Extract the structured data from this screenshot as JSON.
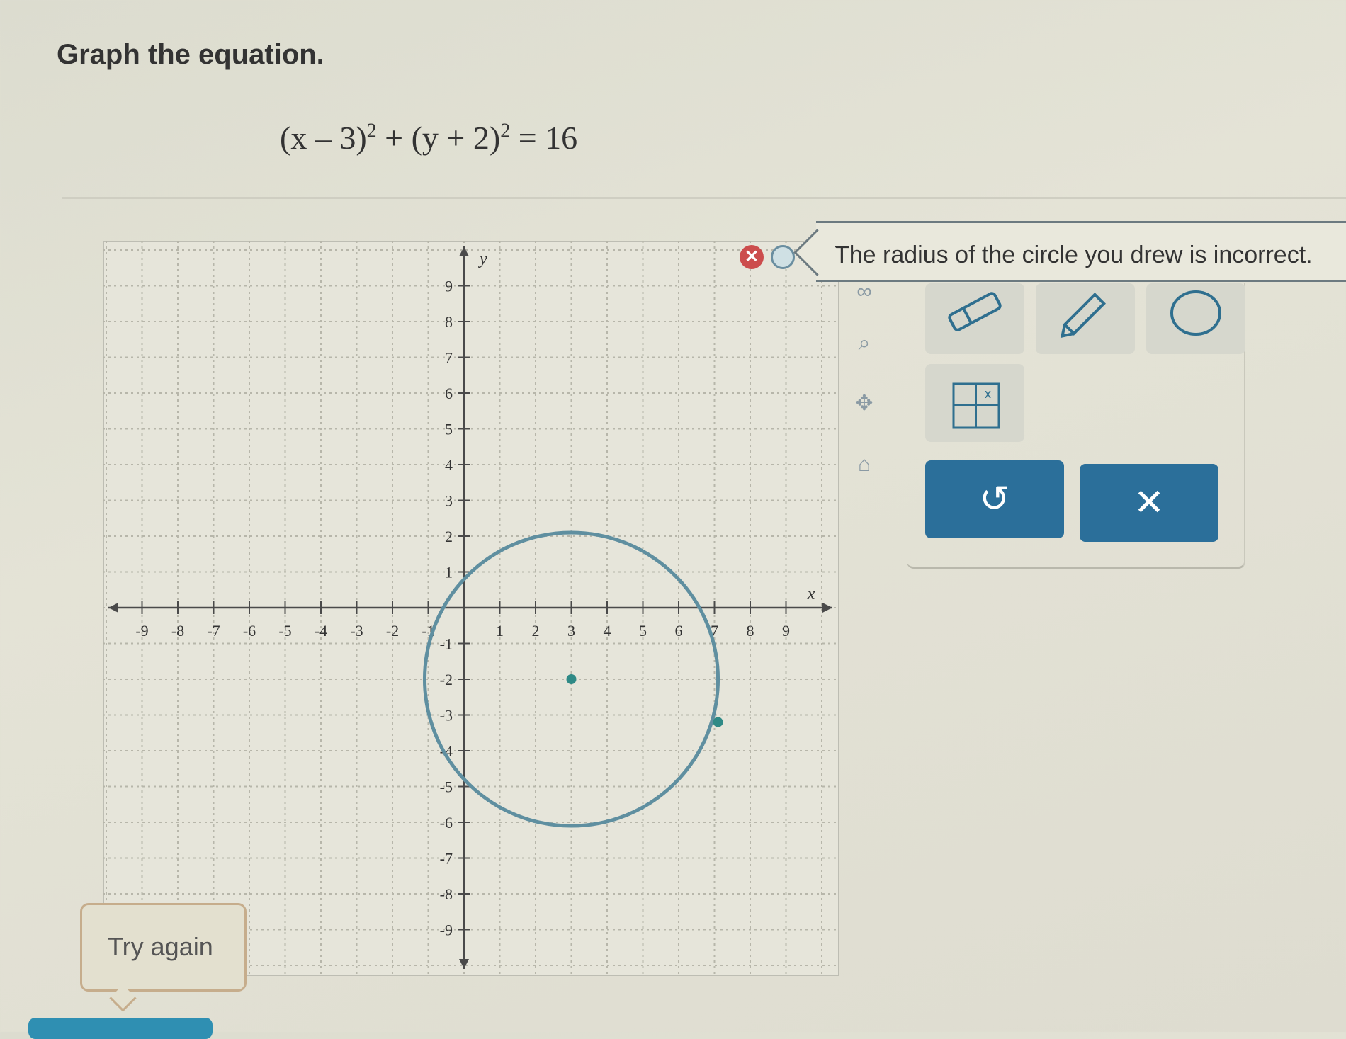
{
  "prompt": "Graph the equation.",
  "equation": {
    "part1": "(x – 3)",
    "exp1": "2",
    "plus": " + ",
    "part2": "(y + 2)",
    "exp2": "2",
    "rhs": " = 16"
  },
  "feedback": "The radius of the circle you drew is incorrect.",
  "try_again": "Try again",
  "tools": {
    "eraser": "eraser-icon",
    "pencil": "pencil-icon",
    "circle": "circle-icon",
    "graph": "graph-icon",
    "undo": "↺",
    "clear": "✕"
  },
  "side_icons": {
    "infinity": "∞",
    "zoom": "⌕",
    "move": "✥",
    "home": "⌂"
  },
  "colors": {
    "circle_stroke": "#5f8fa0",
    "point_fill": "#2f8a86",
    "button_blue": "#2b6f9a",
    "error_red": "#cc4d4d"
  },
  "chart_data": {
    "type": "scatter",
    "xlabel": "x",
    "ylabel": "y",
    "xlim": [
      -10,
      10
    ],
    "ylim": [
      -10,
      10
    ],
    "x_ticks": [
      "-9",
      "-8",
      "-7",
      "-6",
      "-5",
      "-4",
      "-3",
      "-2",
      "-1",
      "1",
      "2",
      "3",
      "4",
      "5",
      "6",
      "7",
      "8",
      "9"
    ],
    "y_ticks": [
      "9",
      "8",
      "7",
      "6",
      "5",
      "4",
      "3",
      "2",
      "1",
      "-1",
      "-2",
      "-3",
      "-4",
      "-5",
      "-6",
      "-7",
      "-8",
      "-9"
    ],
    "grid": true,
    "drawn_circle": {
      "center": [
        3,
        -2
      ],
      "radius": 4.1
    },
    "points": [
      {
        "x": 3,
        "y": -2
      },
      {
        "x": 7.1,
        "y": -3.2
      }
    ]
  }
}
